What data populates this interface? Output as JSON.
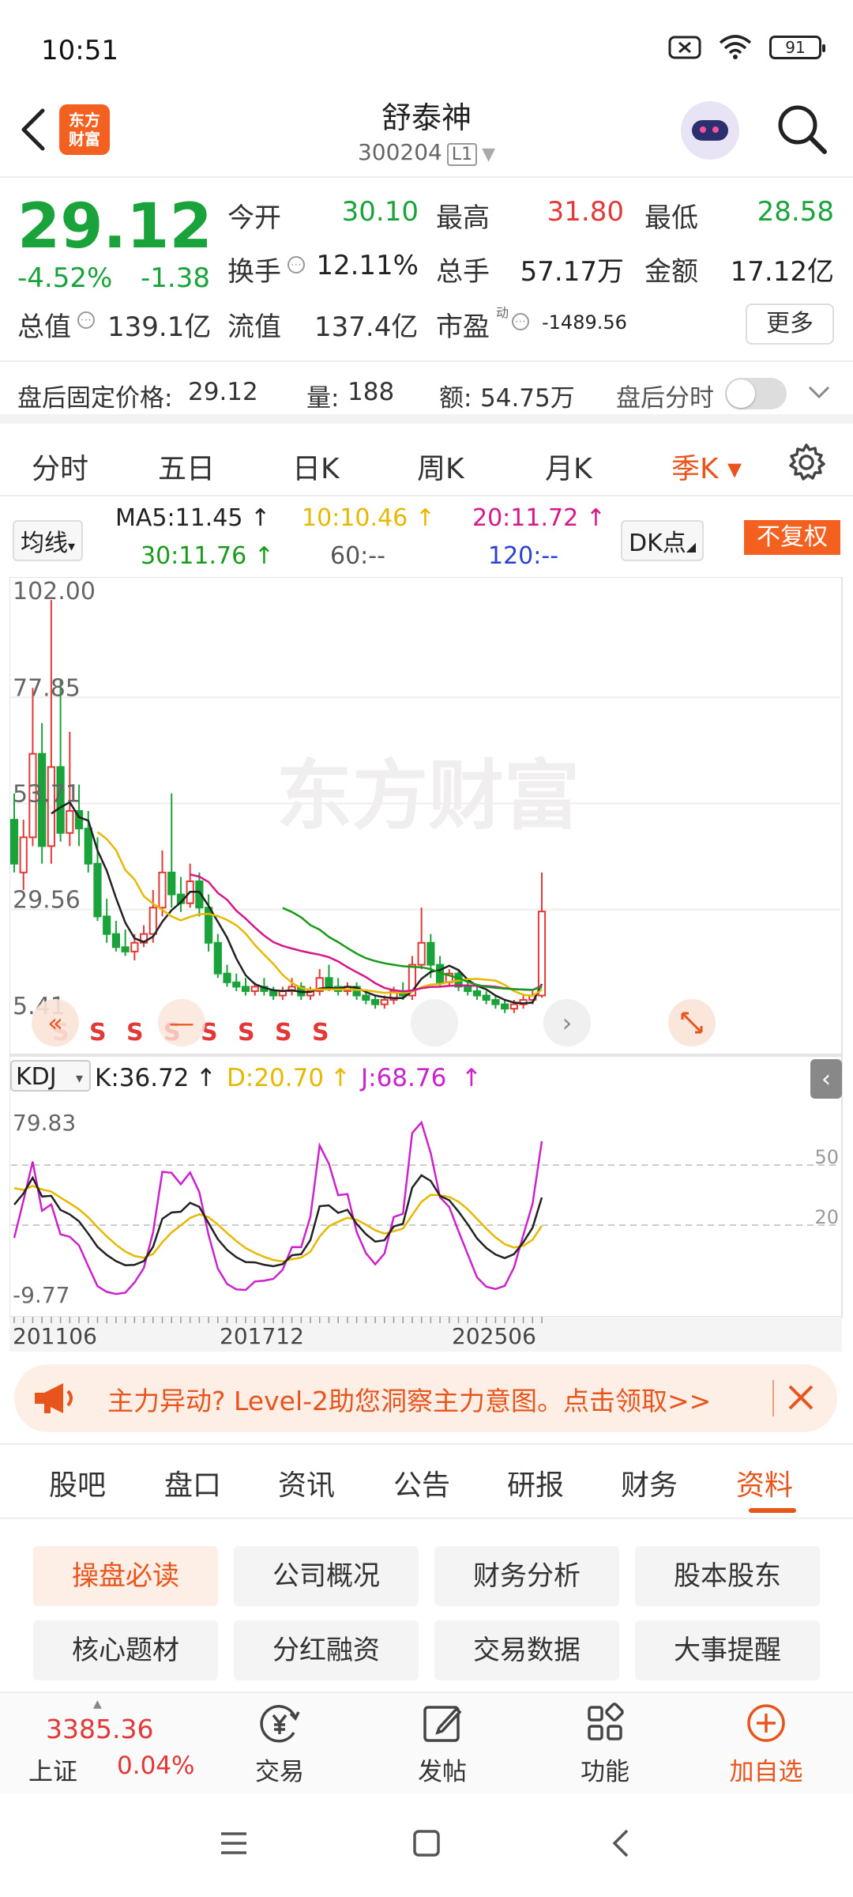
{
  "status": {
    "time": "10:51",
    "battery": "91"
  },
  "header": {
    "logo_text": "东方财富",
    "title": "舒泰神",
    "code": "300204",
    "level": "L1"
  },
  "quote": {
    "price": "29.12",
    "change_pct": "-4.52%",
    "change": "-1.38",
    "rows": [
      [
        {
          "label": "今开",
          "value": "30.10",
          "color": "green"
        },
        {
          "label": "最高",
          "value": "31.80",
          "color": "red"
        },
        {
          "label": "最低",
          "value": "28.58",
          "color": "green"
        }
      ],
      [
        {
          "label": "换手",
          "value": "12.11%",
          "color": "dark"
        },
        {
          "label": "总手",
          "value": "57.17万",
          "color": "dark"
        },
        {
          "label": "金额",
          "value": "17.12亿",
          "color": "dark"
        }
      ]
    ],
    "total_value_label": "总值",
    "total_value": "139.1亿",
    "float_value_label": "流值",
    "float_value": "137.4亿",
    "pe_label": "市盈",
    "pe_sup": "动",
    "pe_value": "-1489.56",
    "more": "更多"
  },
  "after_hours": {
    "price_label": "盘后固定价格:",
    "price": "29.12",
    "vol_label": "量:",
    "vol": "188",
    "amt_label": "额:",
    "amt": "54.75万",
    "timeshare_label": "盘后分时"
  },
  "periods": [
    {
      "label": "分时"
    },
    {
      "label": "五日"
    },
    {
      "label": "日K"
    },
    {
      "label": "周K"
    },
    {
      "label": "月K"
    },
    {
      "label": "季K ▾"
    }
  ],
  "ma_legend": {
    "toggle": "均线",
    "ma5": "MA5:11.45",
    "ma10": "10:10.46",
    "ma20": "20:11.72",
    "ma30": "30:11.76",
    "ma60": "60:--",
    "ma120": "120:--",
    "dk": "DK点",
    "fq": "不复权"
  },
  "colors": {
    "accent": "#e8551c",
    "up": "#e23838",
    "down": "#1aa33a",
    "ma5": "#222222",
    "ma10": "#e6b800",
    "ma20": "#d6168a",
    "ma30": "#1a9a1a",
    "ma60": "#777777",
    "ma120": "#2b3fd6"
  },
  "chart_data": {
    "type": "candlestick",
    "watermark": "东方财富",
    "y_axis_labels": [
      "102.00",
      "77.85",
      "53.71",
      "29.56",
      "5.41"
    ],
    "ylim": [
      5.41,
      102.0
    ],
    "x_axis_labels": [
      "201106",
      "201712",
      "202506"
    ],
    "signal_marks": [
      "S",
      "S",
      "S",
      "S",
      "S",
      "S",
      "S",
      "S"
    ],
    "candles_note": "quarterly candles 2011Q1-2025Q3, approximate",
    "candles": [
      [
        50,
        40,
        56,
        38
      ],
      [
        38,
        46,
        50,
        34
      ],
      [
        46,
        65,
        80,
        44
      ],
      [
        65,
        44,
        72,
        40
      ],
      [
        44,
        62,
        100,
        40
      ],
      [
        62,
        47,
        82,
        45
      ],
      [
        47,
        52,
        70,
        44
      ],
      [
        52,
        48,
        58,
        44
      ],
      [
        48,
        40,
        52,
        38
      ],
      [
        40,
        28,
        46,
        27
      ],
      [
        28,
        24,
        32,
        22
      ],
      [
        24,
        21,
        27,
        20
      ],
      [
        21,
        20,
        25,
        19
      ],
      [
        20,
        22,
        24,
        18
      ],
      [
        22,
        24,
        26,
        21
      ],
      [
        24,
        30,
        34,
        22
      ],
      [
        30,
        38,
        43,
        28
      ],
      [
        38,
        33,
        56,
        30
      ],
      [
        33,
        31,
        37,
        29
      ],
      [
        31,
        36,
        40,
        30
      ],
      [
        36,
        30,
        38,
        28
      ],
      [
        30,
        22,
        33,
        20
      ],
      [
        22,
        15,
        24,
        14
      ],
      [
        15,
        13,
        17,
        12
      ],
      [
        13,
        12,
        15,
        11
      ],
      [
        12,
        11,
        14,
        10
      ],
      [
        11,
        12,
        13,
        10
      ],
      [
        12,
        11,
        14,
        10
      ],
      [
        11,
        10,
        12,
        9
      ],
      [
        10,
        11,
        12,
        9
      ],
      [
        11,
        12,
        14,
        10
      ],
      [
        12,
        10,
        13,
        9
      ],
      [
        10,
        11,
        12,
        9
      ],
      [
        11,
        14,
        16,
        10
      ],
      [
        14,
        12,
        17,
        11
      ],
      [
        12,
        11,
        14,
        10
      ],
      [
        11,
        12,
        13,
        10
      ],
      [
        12,
        10,
        13,
        9
      ],
      [
        10,
        9,
        11,
        8
      ],
      [
        9,
        8,
        10,
        7
      ],
      [
        8,
        9,
        10,
        7
      ],
      [
        9,
        11,
        12,
        8
      ],
      [
        11,
        10,
        13,
        9
      ],
      [
        10,
        17,
        19,
        9
      ],
      [
        17,
        22,
        30,
        16
      ],
      [
        22,
        17,
        24,
        14
      ],
      [
        17,
        13,
        19,
        12
      ],
      [
        13,
        15,
        16,
        12
      ],
      [
        15,
        12,
        16,
        11
      ],
      [
        12,
        11,
        13,
        10
      ],
      [
        11,
        10,
        12,
        9
      ],
      [
        10,
        9,
        11,
        8
      ],
      [
        9,
        8,
        10,
        7
      ],
      [
        8,
        7,
        9,
        6
      ],
      [
        7,
        8,
        9,
        6
      ],
      [
        8,
        9,
        10,
        7
      ],
      [
        9,
        10,
        11,
        8
      ],
      [
        10,
        29.12,
        38,
        9.5
      ]
    ],
    "kdj": {
      "label": "KDJ",
      "K_label": "K:36.72",
      "D_label": "D:20.70",
      "J_label": "J:68.76",
      "y_axis_labels": [
        "79.83",
        "-9.77"
      ],
      "right_labels": [
        "50",
        "20"
      ]
    }
  },
  "banner": {
    "text": "主力异动? Level-2助您洞察主力意图。点击领取>>"
  },
  "content_tabs": [
    {
      "label": "股吧"
    },
    {
      "label": "盘口"
    },
    {
      "label": "资讯"
    },
    {
      "label": "公告"
    },
    {
      "label": "研报"
    },
    {
      "label": "财务"
    },
    {
      "label": "资料"
    }
  ],
  "grid_buttons": [
    {
      "label": "操盘必读"
    },
    {
      "label": "公司概况"
    },
    {
      "label": "财务分析"
    },
    {
      "label": "股本股东"
    },
    {
      "label": "核心题材"
    },
    {
      "label": "分红融资"
    },
    {
      "label": "交易数据"
    },
    {
      "label": "大事提醒"
    }
  ],
  "bottom_nav": {
    "index_value": "3385.36",
    "index_name": "上证",
    "index_change": "0.04%",
    "items": [
      {
        "label": "交易"
      },
      {
        "label": "发帖"
      },
      {
        "label": "功能"
      },
      {
        "label": "加自选"
      }
    ]
  }
}
